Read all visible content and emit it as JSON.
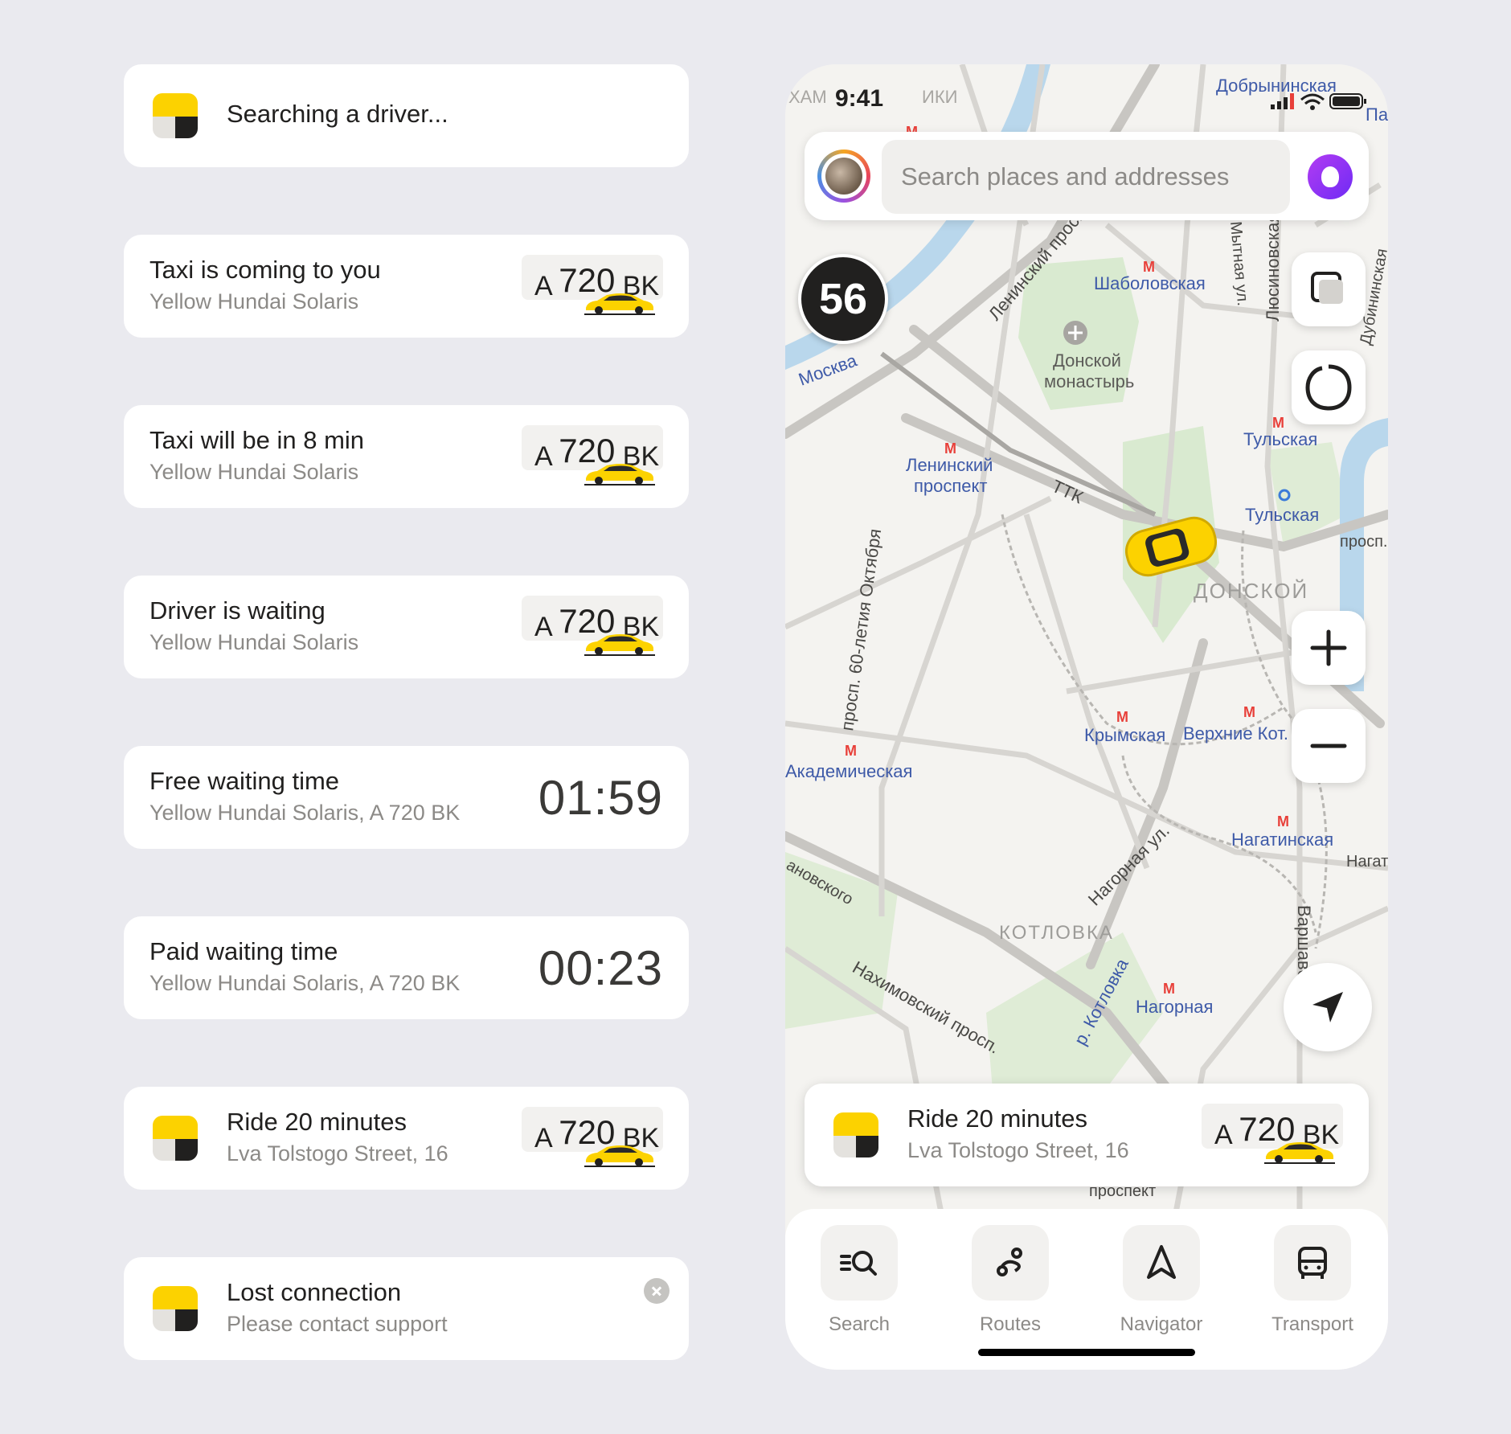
{
  "cards": [
    {
      "title": "Searching a driver...",
      "subtitle": ""
    },
    {
      "title": "Taxi is coming to you",
      "subtitle": "Yellow Hundai Solaris",
      "plate_letter": "A",
      "plate_number": "720",
      "plate_region": "BK"
    },
    {
      "title": "Taxi will be in 8 min",
      "subtitle": "Yellow Hundai Solaris",
      "plate_letter": "A",
      "plate_number": "720",
      "plate_region": "BK"
    },
    {
      "title": "Driver is waiting",
      "subtitle": "Yellow Hundai Solaris",
      "plate_letter": "A",
      "plate_number": "720",
      "plate_region": "BK"
    },
    {
      "title": "Free waiting time",
      "subtitle": "Yellow Hundai Solaris, A 720 BK",
      "timer": "01:59"
    },
    {
      "title": "Paid waiting time",
      "subtitle": "Yellow Hundai Solaris, A 720 BK",
      "timer": "00:23"
    },
    {
      "title": "Ride 20 minutes",
      "subtitle": "Lva Tolstogo Street, 16",
      "plate_letter": "A",
      "plate_number": "720",
      "plate_region": "BK"
    },
    {
      "title": "Lost connection",
      "subtitle": "Please contact support"
    }
  ],
  "phone": {
    "status_time": "9:41",
    "search_placeholder": "Search places and addresses",
    "speed": "56",
    "ride_card": {
      "title": "Ride 20 minutes",
      "subtitle": "Lva Tolstogo Street, 16",
      "plate_letter": "A",
      "plate_number": "720",
      "plate_region": "BK"
    },
    "map_labels": {
      "l1": "Добрынинская",
      "l2": "Шаболовская",
      "l3": "Донской",
      "l3b": "монастырь",
      "l4": "Москва",
      "l5": "Ленинский",
      "l5b": "проспект",
      "l6": "Тульская",
      "l7": "Тульская",
      "l8": "ДОНСКОЙ",
      "l9": "Крымская",
      "l10": "Верхние Кот.",
      "l11": "Академическая",
      "l12": "Нагатинская",
      "l13": "КОТЛОВКА",
      "l14": "Нагорная",
      "l15": "Нахимовский просп.",
      "l16": "просп. 60-летия Октября",
      "l17": "Ленинский просп.",
      "l18": "ТТК",
      "l19": "Люсиновская",
      "l20": "Нагорная ул.",
      "l21": "р. Котловка",
      "l22": "ХАМ",
      "l23": "ИКИ",
      "l24": "Па",
      "l25": "Дубининская",
      "l26": "Варшавское",
      "l27": "Нагат",
      "l28": "просп.",
      "l29": "проспект",
      "l30": "ановского",
      "l31": "Мытная ул."
    },
    "tabs": [
      {
        "label": "Search",
        "icon": "search-list-icon"
      },
      {
        "label": "Routes",
        "icon": "routes-icon"
      },
      {
        "label": "Navigator",
        "icon": "navigator-icon"
      },
      {
        "label": "Transport",
        "icon": "bus-icon"
      }
    ]
  },
  "colors": {
    "brand_yellow": "#fcd200",
    "background": "#eaeaef",
    "metro_red": "#e8403a",
    "text_secondary": "#8c8a87"
  }
}
